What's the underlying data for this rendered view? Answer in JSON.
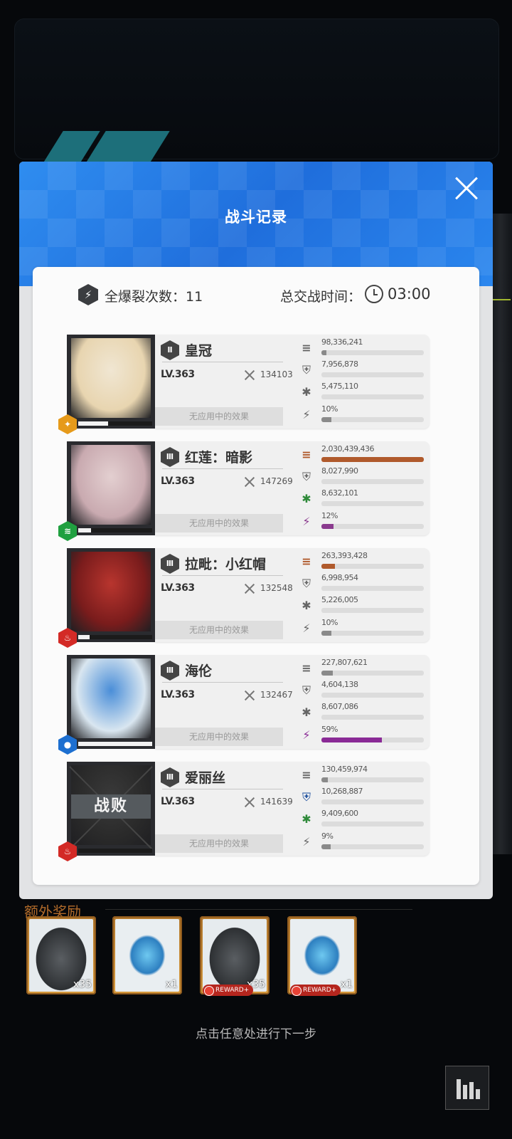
{
  "modal": {
    "title": "战斗记录",
    "burst_count_text": "全爆裂次数：11",
    "total_time_label": "总交战时间：",
    "total_time_value": "03:00"
  },
  "units": [
    {
      "name": "皇冠",
      "burst_stage": "Ⅱ",
      "level": "LV.363",
      "power": "134103",
      "effect_text": "无应用中的效果",
      "element": "iron",
      "element_color": "#e69a1a",
      "defeated": false,
      "defeated_label": "",
      "hp_fraction": 0.4,
      "stats": [
        {
          "icon": "damage-icon",
          "value": "98,336,241",
          "fraction": 0.05,
          "color": "#8a8a8a"
        },
        {
          "icon": "shield-icon",
          "value": "7,956,878",
          "fraction": 0.0,
          "color": "#8a8a8a"
        },
        {
          "icon": "heal-icon",
          "value": "5,475,110",
          "fraction": 0.0,
          "color": "#8a8a8a"
        },
        {
          "icon": "burst-gauge-icon",
          "value": "10%",
          "fraction": 0.1,
          "color": "#8a8a8a"
        }
      ]
    },
    {
      "name": "红莲：暗影",
      "burst_stage": "Ⅲ",
      "level": "LV.363",
      "power": "147269",
      "effect_text": "无应用中的效果",
      "element": "wind",
      "element_color": "#20a040",
      "defeated": false,
      "defeated_label": "",
      "hp_fraction": 0.17,
      "stats": [
        {
          "icon": "damage-icon",
          "value": "2,030,439,436",
          "fraction": 1.0,
          "color": "#b05a2c"
        },
        {
          "icon": "shield-icon",
          "value": "8,027,990",
          "fraction": 0.0,
          "color": "#8a8a8a"
        },
        {
          "icon": "heal-icon",
          "value": "8,632,101",
          "fraction": 0.0,
          "color": "#2f8a3a"
        },
        {
          "icon": "burst-gauge-icon",
          "value": "12%",
          "fraction": 0.12,
          "color": "#8a3a8e"
        }
      ]
    },
    {
      "name": "拉毗：小红帽",
      "burst_stage": "Ⅲ",
      "level": "LV.363",
      "power": "132548",
      "effect_text": "无应用中的效果",
      "element": "fire",
      "element_color": "#d32a26",
      "defeated": false,
      "defeated_label": "",
      "hp_fraction": 0.15,
      "stats": [
        {
          "icon": "damage-icon",
          "value": "263,393,428",
          "fraction": 0.13,
          "color": "#b05a2c"
        },
        {
          "icon": "shield-icon",
          "value": "6,998,954",
          "fraction": 0.0,
          "color": "#8a8a8a"
        },
        {
          "icon": "heal-icon",
          "value": "5,226,005",
          "fraction": 0.0,
          "color": "#8a8a8a"
        },
        {
          "icon": "burst-gauge-icon",
          "value": "10%",
          "fraction": 0.1,
          "color": "#8a8a8a"
        }
      ]
    },
    {
      "name": "海伦",
      "burst_stage": "Ⅲ",
      "level": "LV.363",
      "power": "132467",
      "effect_text": "无应用中的效果",
      "element": "water",
      "element_color": "#1d6fd0",
      "defeated": false,
      "defeated_label": "",
      "hp_fraction": 1.0,
      "stats": [
        {
          "icon": "damage-icon",
          "value": "227,807,621",
          "fraction": 0.11,
          "color": "#8a8a8a"
        },
        {
          "icon": "shield-icon",
          "value": "4,604,138",
          "fraction": 0.0,
          "color": "#8a8a8a"
        },
        {
          "icon": "heal-icon",
          "value": "8,607,086",
          "fraction": 0.0,
          "color": "#8a8a8a"
        },
        {
          "icon": "burst-gauge-icon",
          "value": "59%",
          "fraction": 0.59,
          "color": "#8a2a96"
        }
      ]
    },
    {
      "name": "爱丽丝",
      "burst_stage": "Ⅲ",
      "level": "LV.363",
      "power": "141639",
      "effect_text": "无应用中的效果",
      "element": "fire",
      "element_color": "#d32a26",
      "defeated": true,
      "defeated_label": "战败",
      "hp_fraction": 0.0,
      "stats": [
        {
          "icon": "damage-icon",
          "value": "130,459,974",
          "fraction": 0.06,
          "color": "#8a8a8a"
        },
        {
          "icon": "shield-icon",
          "value": "10,268,887",
          "fraction": 0.0,
          "color": "#1d4f9e"
        },
        {
          "icon": "heal-icon",
          "value": "9,409,600",
          "fraction": 0.0,
          "color": "#2f8a3a"
        },
        {
          "icon": "burst-gauge-icon",
          "value": "9%",
          "fraction": 0.09,
          "color": "#8a8a8a"
        }
      ]
    }
  ],
  "bonus": {
    "label": "额外奖励",
    "items": [
      {
        "icon": "equipment-box-icon",
        "count": "x35",
        "reward_plus": false
      },
      {
        "icon": "crystal-icon",
        "count": "x1",
        "reward_plus": false
      },
      {
        "icon": "equipment-box-icon",
        "count": "x35",
        "reward_plus": true
      },
      {
        "icon": "crystal-icon",
        "count": "x1",
        "reward_plus": true
      }
    ],
    "reward_plus_label": "REWARD+"
  },
  "hint": "点击任意处进行下一步"
}
